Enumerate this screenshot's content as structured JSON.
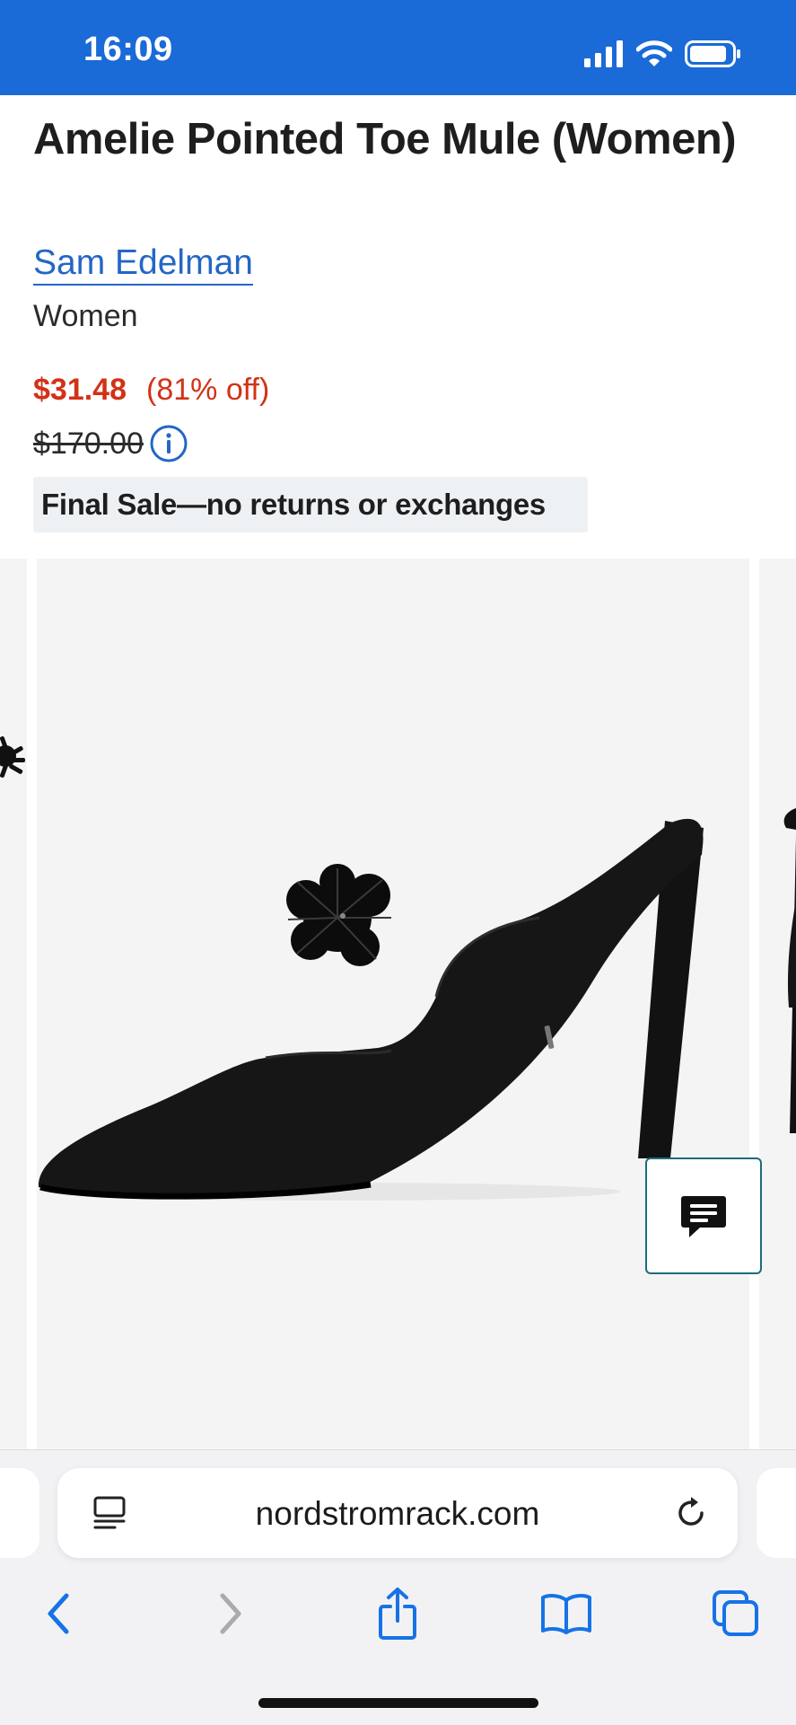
{
  "status_bar": {
    "time": "16:09"
  },
  "product": {
    "title": "Amelie Pointed Toe Mule (Women)",
    "brand": "Sam Edelman",
    "category": "Women",
    "sale_price": "$31.48",
    "discount": "(81% off)",
    "original_price": "$170.00",
    "final_sale_notice": "Final Sale—no returns or exchanges"
  },
  "browser": {
    "url": "nordstromrack.com"
  },
  "colors": {
    "status_bar": "#1a6ad8",
    "sale_price": "#d23216",
    "brand_link": "#2466c6",
    "browser_accent": "#1673e6"
  },
  "icons": {
    "info": "info-icon",
    "chat": "chat-icon",
    "reader": "reader-icon",
    "reload": "reload-icon",
    "back": "back-icon",
    "forward": "forward-icon",
    "share": "share-icon",
    "bookmarks": "bookmarks-icon",
    "tabs": "tabs-icon"
  }
}
